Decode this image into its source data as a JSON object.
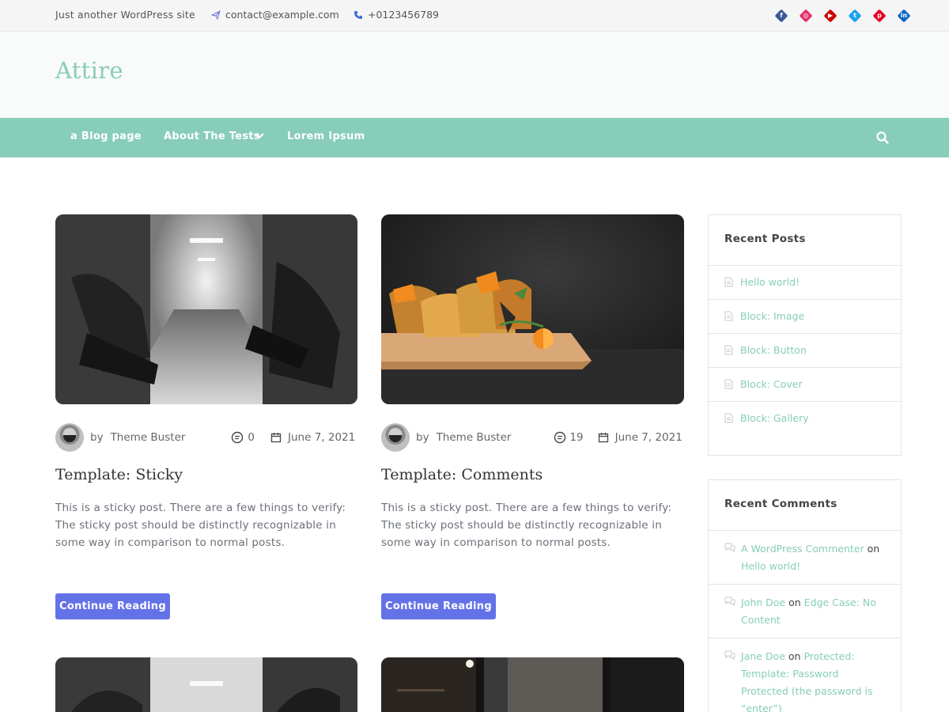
{
  "topbar": {
    "tagline": "Just another WordPress site",
    "email": "contact@example.com",
    "phone": "+0123456789",
    "socials": [
      {
        "name": "facebook",
        "glyph": "f",
        "color": "#3b5998"
      },
      {
        "name": "instagram",
        "glyph": "◎",
        "color": "#e1306c"
      },
      {
        "name": "youtube",
        "glyph": "▶",
        "color": "#cc0000"
      },
      {
        "name": "twitter",
        "glyph": "t",
        "color": "#1da1f2"
      },
      {
        "name": "pinterest",
        "glyph": "p",
        "color": "#e60023"
      },
      {
        "name": "linkedin",
        "glyph": "in",
        "color": "#0a66c2"
      }
    ]
  },
  "header": {
    "site_title": "Attire"
  },
  "nav": {
    "items": [
      {
        "label": "a Blog page"
      },
      {
        "label": "About The Tests",
        "has_submenu": true
      },
      {
        "label": "Lorem Ipsum"
      }
    ]
  },
  "posts": [
    {
      "author_prefix": "by",
      "author": "Theme Buster",
      "comments": "0",
      "date": "June 7, 2021",
      "title": "Template: Sticky",
      "excerpt": "This is a sticky post. There are a few things to verify: The sticky post should be distinctly recognizable in some way in comparison to normal posts.",
      "button": "Continue Reading"
    },
    {
      "author_prefix": "by",
      "author": "Theme Buster",
      "comments": "19",
      "date": "June 7, 2021",
      "title": "Template: Comments",
      "excerpt": "This is a sticky post. There are a few things to verify: The sticky post should be distinctly recognizable in some way in comparison to normal posts.",
      "button": "Continue Reading"
    }
  ],
  "sidebar": {
    "recent_posts": {
      "title": "Recent Posts",
      "items": [
        "Hello world!",
        "Block: Image",
        "Block: Button",
        "Block: Cover",
        "Block: Gallery"
      ]
    },
    "recent_comments": {
      "title": "Recent Comments",
      "items": [
        {
          "author": "A WordPress Commenter",
          "on": "on",
          "post": "Hello world!"
        },
        {
          "author": "John Doe",
          "on": "on",
          "post": "Edge Case: No Content"
        },
        {
          "author": "Jane Doe",
          "on": "on",
          "post": "Protected: Template: Password Protected (the password is “enter”)"
        }
      ]
    }
  },
  "colors": {
    "accent": "#87cdba",
    "button": "#6472e8",
    "link": "#87cdb9"
  }
}
